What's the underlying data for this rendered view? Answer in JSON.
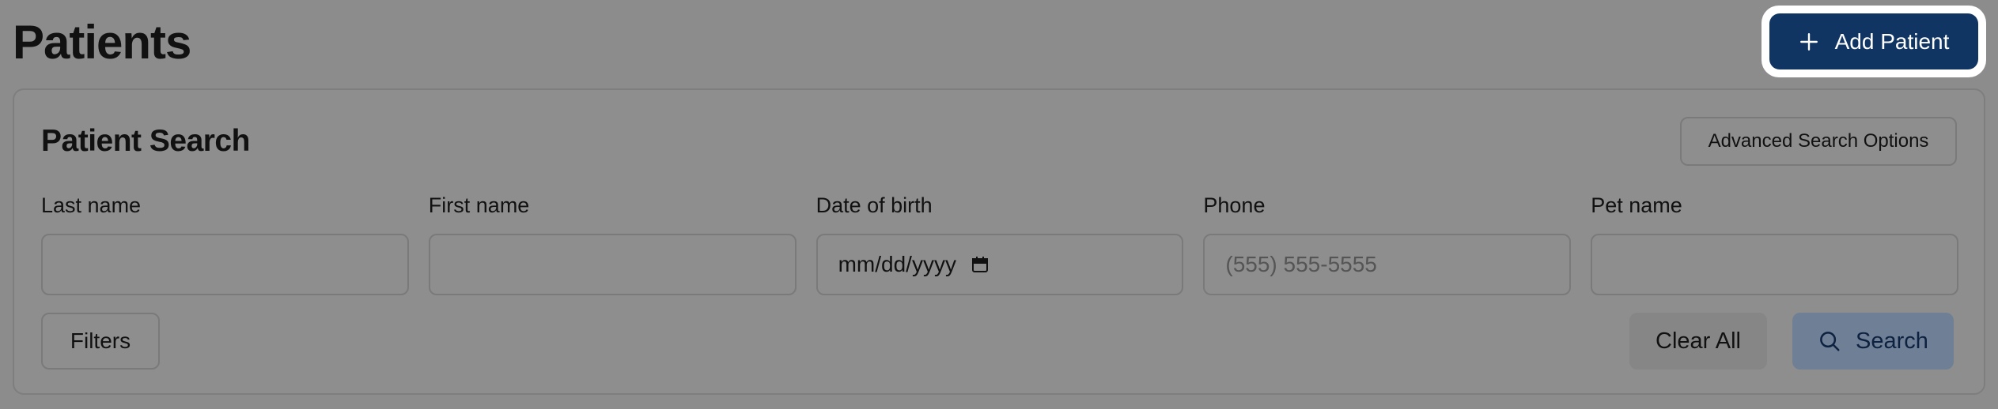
{
  "header": {
    "title": "Patients",
    "add_button_label": "Add Patient",
    "add_icon": "plus-icon"
  },
  "search": {
    "title": "Patient Search",
    "advanced_label": "Advanced Search Options",
    "fields": [
      {
        "label": "Last name",
        "value": "",
        "placeholder": ""
      },
      {
        "label": "First name",
        "value": "",
        "placeholder": ""
      },
      {
        "label": "Date of birth",
        "value": "mm/dd/yyyy",
        "placeholder": "",
        "icon": "calendar-icon"
      },
      {
        "label": "Phone",
        "value": "",
        "placeholder": "(555) 555-5555"
      },
      {
        "label": "Pet name",
        "value": "",
        "placeholder": ""
      }
    ],
    "filters_label": "Filters",
    "clear_label": "Clear All",
    "search_label": "Search",
    "search_icon": "search-icon"
  },
  "colors": {
    "primary": "#113563",
    "overlay": "#8c8c8c",
    "search_button": "#6f7f95"
  }
}
